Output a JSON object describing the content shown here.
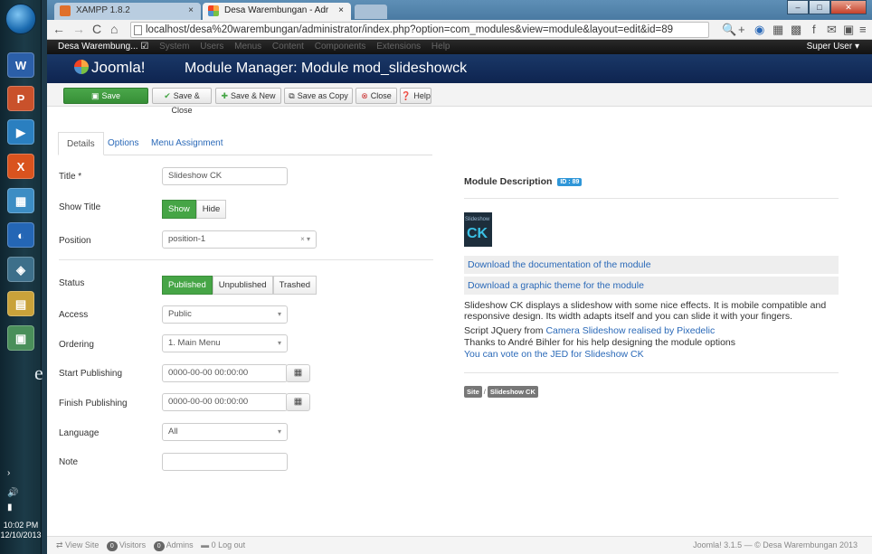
{
  "taskbar": {
    "apps": [
      "W",
      "P",
      "▶",
      "X",
      "▦",
      "◐",
      "◈",
      "▤",
      "▣"
    ],
    "tray_char": "e",
    "time": "10:02 PM",
    "date": "12/10/2013"
  },
  "browser": {
    "tabs": [
      {
        "label": "XAMPP 1.8.2",
        "close": "×"
      },
      {
        "label": "Desa Warembungan - Adr",
        "close": "×"
      }
    ],
    "url": "localhost/desa%20warembungan/administrator/index.php?option=com_modules&view=module&layout=edit&id=89"
  },
  "admin_nav": {
    "site": "Desa Warembung... ☑",
    "menu": [
      "System",
      "Users",
      "Menus",
      "Content",
      "Components",
      "Extensions",
      "Help"
    ],
    "user": "Super User ▾"
  },
  "header": {
    "logo": "Joomla!",
    "title": "Module Manager: Module mod_slideshowck"
  },
  "toolbar": {
    "save": "Save",
    "save_close": "Save & Close",
    "save_new": "Save & New",
    "save_copy": "Save as Copy",
    "close": "Close",
    "help": "Help"
  },
  "tabs": [
    "Details",
    "Options",
    "Menu Assignment"
  ],
  "form": {
    "title_label": "Title *",
    "title_value": "Slideshow CK",
    "show_title_label": "Show Title",
    "show_title_options": [
      "Show",
      "Hide"
    ],
    "position_label": "Position",
    "position_value": "position-1",
    "status_label": "Status",
    "status_options": [
      "Published",
      "Unpublished",
      "Trashed"
    ],
    "access_label": "Access",
    "access_value": "Public",
    "ordering_label": "Ordering",
    "ordering_value": "1. Main Menu",
    "start_label": "Start Publishing",
    "start_value": "0000-00-00 00:00:00",
    "finish_label": "Finish Publishing",
    "finish_value": "0000-00-00 00:00:00",
    "language_label": "Language",
    "language_value": "All",
    "note_label": "Note",
    "note_value": ""
  },
  "description": {
    "heading": "Module Description",
    "id_badge": "ID : 89",
    "logo_small": "Slideshow",
    "logo_big": "CK",
    "download_doc": "Download the documentation of the module",
    "download_theme": "Download a graphic theme for the module",
    "para1": "Slideshow CK displays a slideshow with some nice effects. It is mobile compatible and responsive design. Its width adapts itself and you can slide it with your fingers.",
    "script_prefix": "Script JQuery from ",
    "script_link": "Camera Slideshow realised by Pixedelic",
    "thanks": "Thanks to André Bihler for his help designing the module options",
    "vote": "You can vote on the JED for Slideshow CK",
    "crumbs": [
      "Site",
      "Slideshow CK"
    ],
    "crumb_separator": "/"
  },
  "statusbar": {
    "view_site": "View Site",
    "visitors_count": "0",
    "visitors": "Visitors",
    "admins_count": "0",
    "admins": "Admins",
    "logout": "0 Log out",
    "copyright": "Joomla! 3.1.5 — © Desa Warembungan 2013"
  }
}
